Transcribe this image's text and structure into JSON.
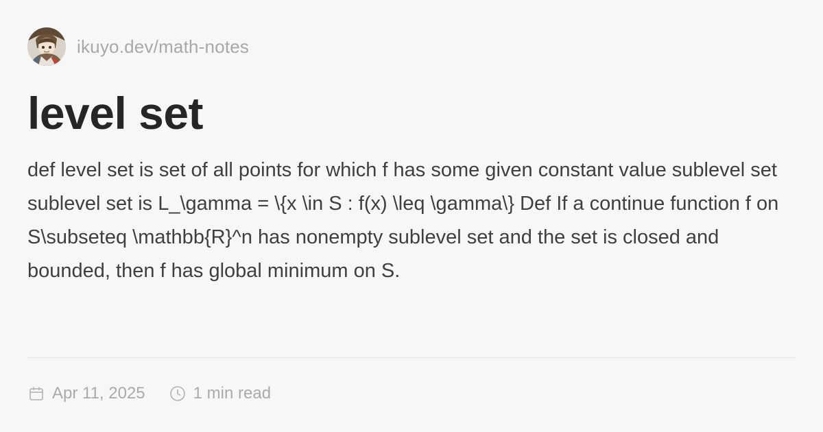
{
  "site": {
    "url": "ikuyo.dev/math-notes"
  },
  "post": {
    "title": "level set",
    "excerpt": "def level set is set of all points for which f has some given constant value sublevel set sublevel set is L_\\gamma = \\{x \\in S : f(x) \\leq \\gamma\\} Def If a continue function f on S\\subseteq \\mathbb{R}^n has nonempty sublevel set and the set is closed and bounded, then f has global minimum on S.",
    "date": "Apr 11, 2025",
    "reading_time": "1 min read"
  },
  "icons": {
    "date": "calendar-icon",
    "reading_time": "clock-icon"
  },
  "colors": {
    "background": "#f8f7f8",
    "title": "#262626",
    "body_text": "#3f3f3f",
    "muted": "#aaaaaa",
    "divider": "#e4e3e4"
  }
}
